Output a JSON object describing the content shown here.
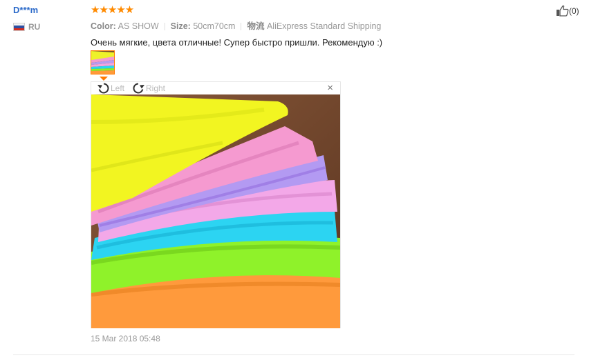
{
  "author": {
    "name": "D***m",
    "country": "RU"
  },
  "review": {
    "stars": "★★★★★",
    "color_label": "Color:",
    "color_value": "AS SHOW",
    "size_label": "Size:",
    "size_value": "50cm70cm",
    "shipping_label": "物流",
    "shipping_value": "AliExpress Standard Shipping",
    "text": "Очень мягкие, цвета отличные! Супер быстро пришли. Рекомендую :)",
    "date": "15 Mar 2018 05:48"
  },
  "viewer": {
    "rotate_left": "Left",
    "rotate_right": "Right",
    "close": "×"
  },
  "helpful": {
    "count": "(0)"
  },
  "icons": [
    "flag-ru-icon",
    "star-icon",
    "rotate-left-icon",
    "rotate-right-icon",
    "close-icon",
    "thumbs-up-icon"
  ],
  "colors": {
    "author": "#2a69c9",
    "stars": "#ff8a00",
    "accent": "#ff7a00"
  }
}
